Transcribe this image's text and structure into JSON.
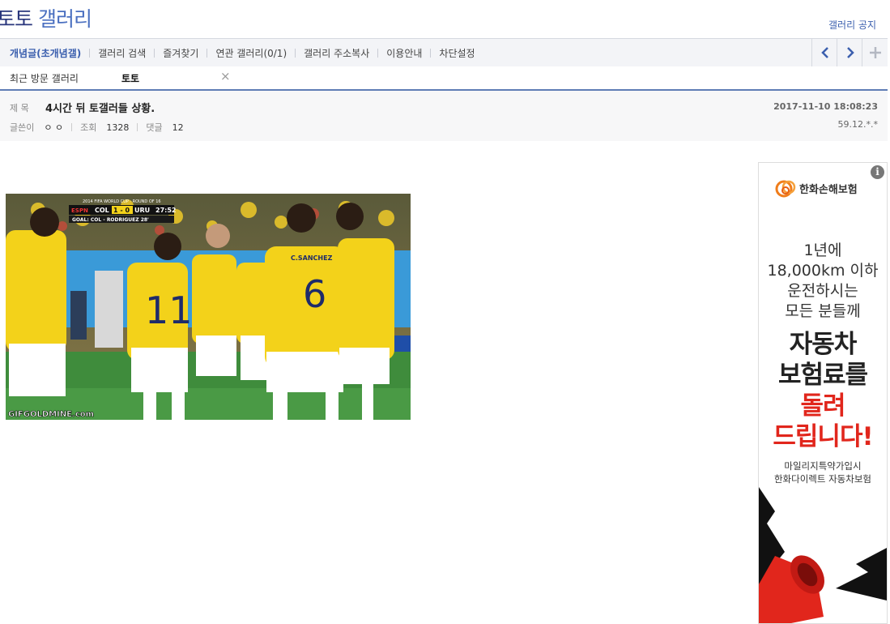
{
  "header": {
    "title_prefix": "토토",
    "title_accent": "갤러리",
    "notice_link": "갤러리 공지"
  },
  "nav": {
    "items": [
      {
        "label": "개념글(초개념갤)",
        "active": true
      },
      {
        "label": "갤러리 검색"
      },
      {
        "label": "즐겨찾기"
      },
      {
        "label": "연관 갤러리(0/1)"
      },
      {
        "label": "갤러리 주소복사"
      },
      {
        "label": "이용안내"
      },
      {
        "label": "차단설정"
      }
    ],
    "prev_icon": "chevron-left-icon",
    "next_icon": "chevron-right-icon",
    "add_icon": "plus-icon"
  },
  "recent": {
    "label": "최근 방문 갤러리",
    "item": "토토",
    "close": "×"
  },
  "post": {
    "subject_label": "제 목",
    "subject": "4시간 뒤 토갤러들 상황.",
    "date": "2017-11-10 18:08:23",
    "author_label": "글쓴이",
    "author": "ㅇ ㅇ",
    "ip": "59.12.*.*",
    "views_label": "조회",
    "views": "1328",
    "comments_label": "댓글",
    "comments": "12",
    "image": {
      "watermark": "GIFGOLDMINE.com",
      "score_home": "COL",
      "score": "1 - 0",
      "score_away": "URU",
      "clock": "27:52",
      "goal_line": "GOAL: COL - RODRIGUEZ 28'",
      "event": "2014 FIFA WORLD CUP · ROUND OF 16",
      "broadcaster": "ESPN",
      "jersey_name": "C.SANCHEZ",
      "jersey_number_a": "11",
      "jersey_number_b": "6"
    }
  },
  "ad": {
    "brand": "한화손해보험",
    "line1": "1년에",
    "line2": "18,000km 이하",
    "line3": "운전하시는",
    "line4": "모든 분들께",
    "big1": "자동차",
    "big2": "보험료를",
    "big3": "돌려",
    "big4": "드립니다!",
    "small1": "마일리지특약가입시",
    "small2": "한화다이렉트 자동차보험",
    "info": "i"
  },
  "colors": {
    "accent": "#3b5fae",
    "title_dark": "#29367c",
    "ad_red": "#e1261c",
    "jersey_yellow": "#f3d21a"
  }
}
